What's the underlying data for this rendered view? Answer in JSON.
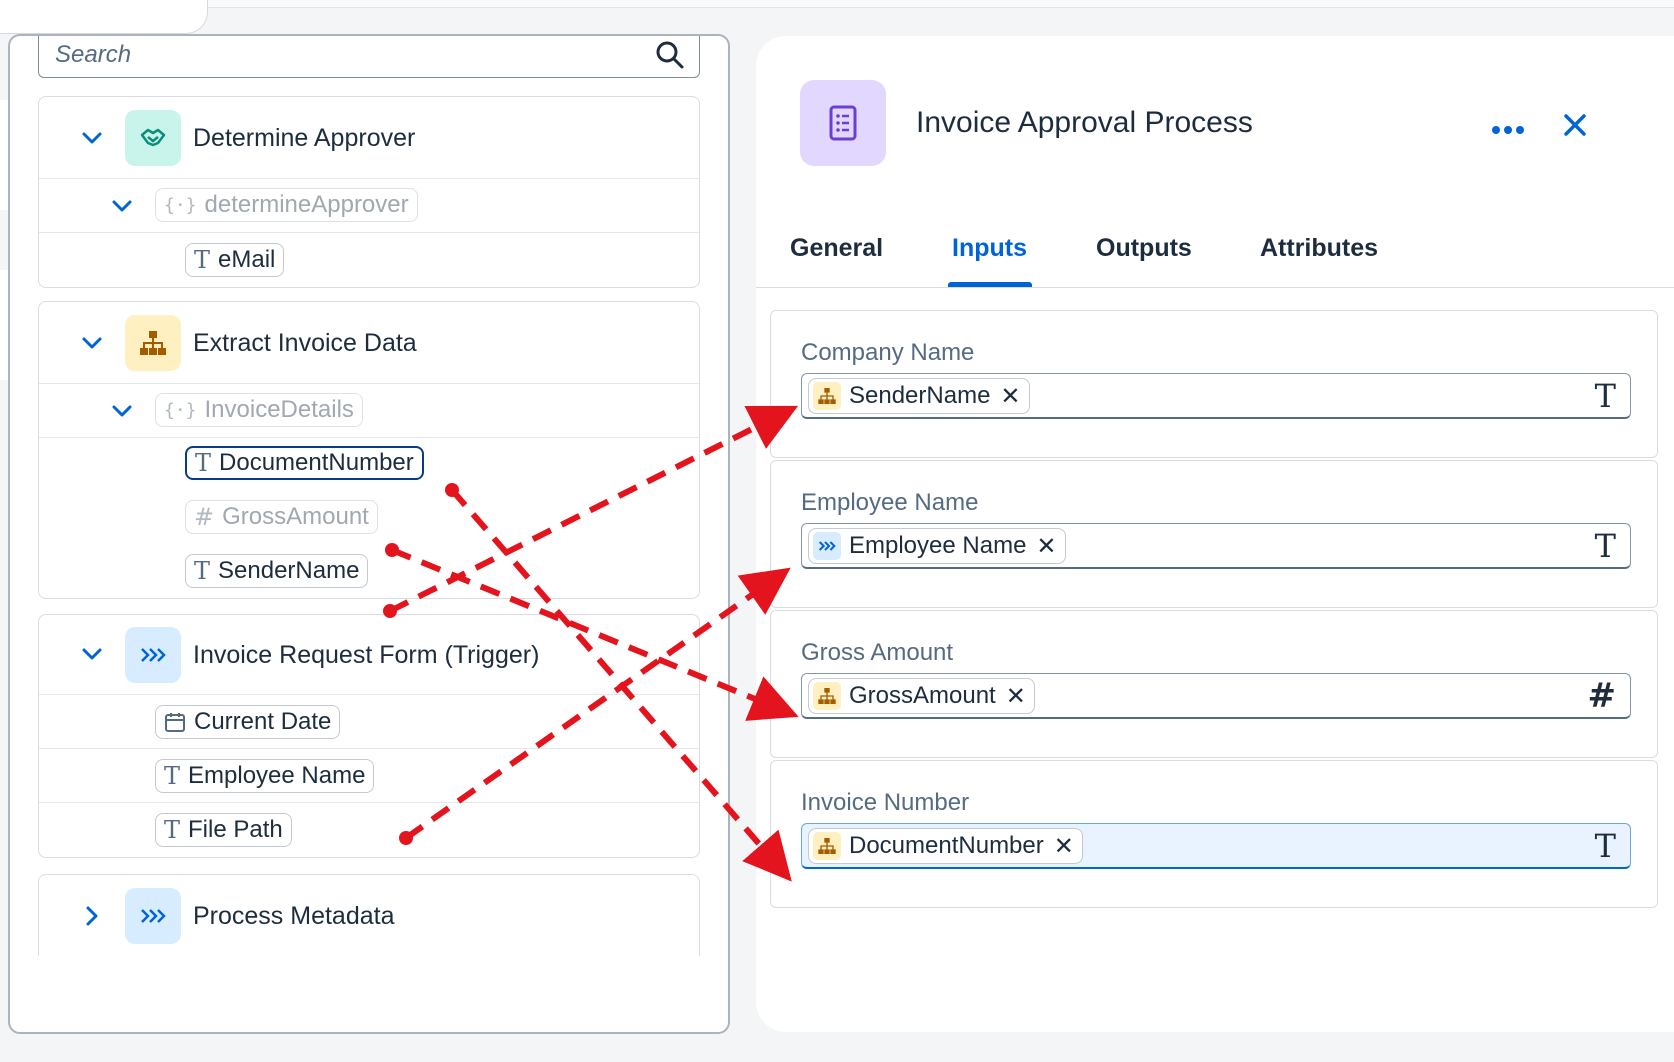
{
  "search": {
    "placeholder": "Search"
  },
  "tree": {
    "groups": [
      {
        "title": "Determine Approver",
        "sub": "determineApprover",
        "items": [
          "eMail"
        ]
      },
      {
        "title": "Extract Invoice Data",
        "sub": "InvoiceDetails",
        "items": [
          "DocumentNumber",
          "GrossAmount",
          "SenderName"
        ]
      },
      {
        "title": "Invoice Request Form (Trigger)",
        "items": [
          "Current Date",
          "Employee Name",
          "File Path"
        ]
      },
      {
        "title": "Process Metadata"
      }
    ]
  },
  "details": {
    "title": "Invoice Approval Process",
    "tabs": [
      "General",
      "Inputs",
      "Outputs",
      "Attributes"
    ],
    "active_tab": "Inputs",
    "fields": [
      {
        "label": "Company Name",
        "token": "SenderName",
        "token_type": "T",
        "token_source": "extract"
      },
      {
        "label": "Employee Name",
        "token": "Employee Name",
        "token_type": "T",
        "token_source": "trigger"
      },
      {
        "label": "Gross Amount",
        "token": "GrossAmount",
        "token_type": "#",
        "token_source": "extract"
      },
      {
        "label": "Invoice Number",
        "token": "DocumentNumber",
        "token_type": "T",
        "token_source": "extract"
      }
    ]
  },
  "colors": {
    "accent": "#0064d9",
    "arrow": "#e3141d",
    "approver_icon_bg": "#c9f4ec",
    "extract_icon_bg": "#fff0c2",
    "trigger_icon_bg": "#d8ecff",
    "header_icon_bg": "#e2d8ff"
  },
  "icons": {
    "approver": "handshake-icon",
    "extract": "hierarchy-icon",
    "trigger": "forward-chevrons-icon",
    "header": "document-list-icon"
  }
}
